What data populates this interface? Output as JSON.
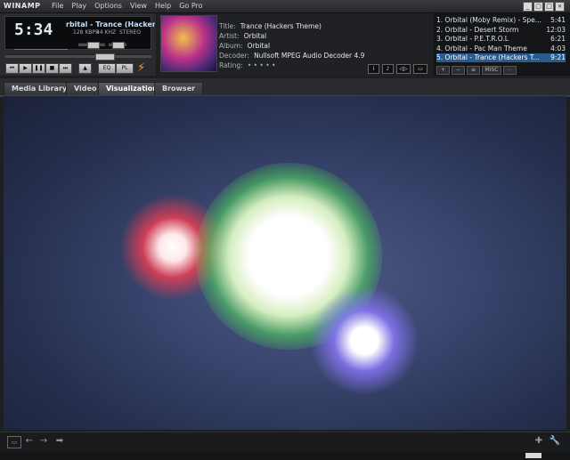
{
  "titlebar": {
    "brand": "WINAMP",
    "menu": [
      "File",
      "Play",
      "Options",
      "View",
      "Help",
      "Go Pro"
    ],
    "min": "_",
    "shade": "▢",
    "max": "□",
    "close": "×"
  },
  "player": {
    "time": "5:34",
    "scroll_title": "rbital - Trance (Hackers Theme)",
    "kbps": "128 KBPS",
    "khz": "44 KHZ",
    "stereo": "STEREO",
    "controls": [
      "prev",
      "play",
      "pause",
      "stop",
      "next"
    ],
    "eject_label": "▲",
    "eq_label": "EQ",
    "pl_label": "PL",
    "volume_level": 0.55,
    "balance_level": 0.5,
    "seek_level": 0.7
  },
  "info": {
    "title_label": "Title:",
    "title_value": "Trance (Hackers Theme)",
    "artist_label": "Artist:",
    "artist_value": "Orbital",
    "album_label": "Album:",
    "album_value": "Orbital",
    "decoder_label": "Decoder:",
    "decoder_value": "Nullsoft MPEG Audio Decoder 4.9",
    "rating_label": "Rating:",
    "rating_value": "• • • • •",
    "buttons": [
      "i",
      "♪",
      "◁▷",
      "▭"
    ]
  },
  "playlist": {
    "items": [
      {
        "title": "1. Orbital (Moby Remix) - Spe...",
        "time": "5:41"
      },
      {
        "title": "2. Orbital - Desert Storm",
        "time": "12:03"
      },
      {
        "title": "3. Orbital - P.E.T.R.O.L",
        "time": "6:21"
      },
      {
        "title": "4. Orbital - Pac Man Theme",
        "time": "4:03"
      },
      {
        "title": "5. Orbital - Trance (Hackers T...",
        "time": "9:21"
      }
    ],
    "selected_index": 4,
    "buttons": [
      "+",
      "−",
      "≡",
      "MISC",
      "⋯"
    ]
  },
  "tabs": [
    "Media Library",
    "Video",
    "Visualization",
    "Browser"
  ],
  "active_tab": "Visualization",
  "colors": {
    "accent": "#2a5b8f",
    "bolt": "#f5a020",
    "viz_bg": "#3a466f"
  }
}
